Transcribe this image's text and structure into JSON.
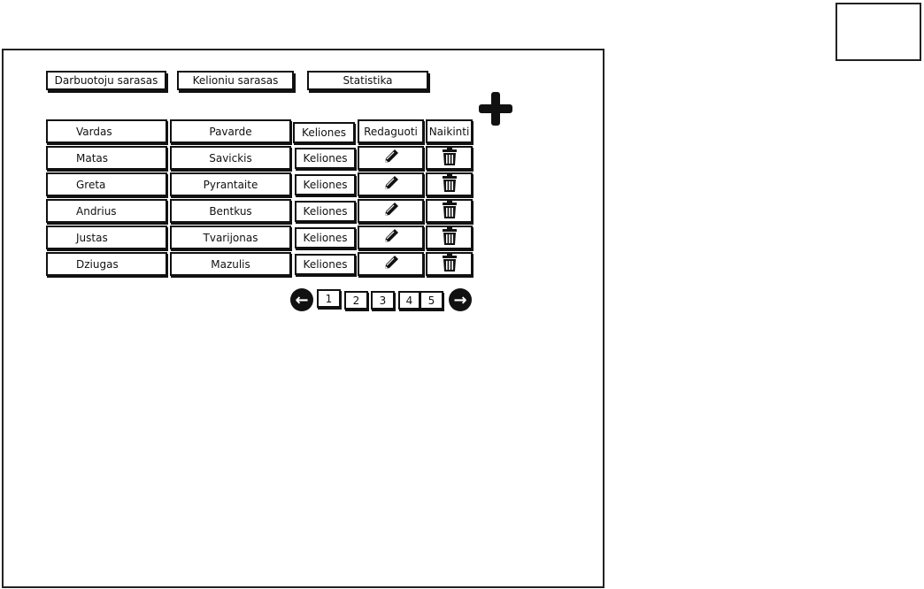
{
  "nav": [
    "Darbuotoju sarasas",
    "Kelioniu sarasas",
    "Statistika"
  ],
  "table": {
    "headers": [
      "Vardas",
      "Pavarde",
      "Keliones",
      "Redaguoti",
      "Naikinti"
    ],
    "rows": [
      {
        "vardas": "Matas",
        "pavarde": "Savickis",
        "keliones": "Keliones"
      },
      {
        "vardas": "Greta",
        "pavarde": "Pyrantaite",
        "keliones": "Keliones"
      },
      {
        "vardas": "Andrius",
        "pavarde": "Bentkus",
        "keliones": "Keliones"
      },
      {
        "vardas": "Justas",
        "pavarde": "Tvarijonas",
        "keliones": "Keliones"
      },
      {
        "vardas": "Dziugas",
        "pavarde": "Mazulis",
        "keliones": "Keliones"
      }
    ]
  },
  "pagination": {
    "pages": [
      "1",
      "2",
      "3",
      "4",
      "5"
    ],
    "current": "1"
  }
}
